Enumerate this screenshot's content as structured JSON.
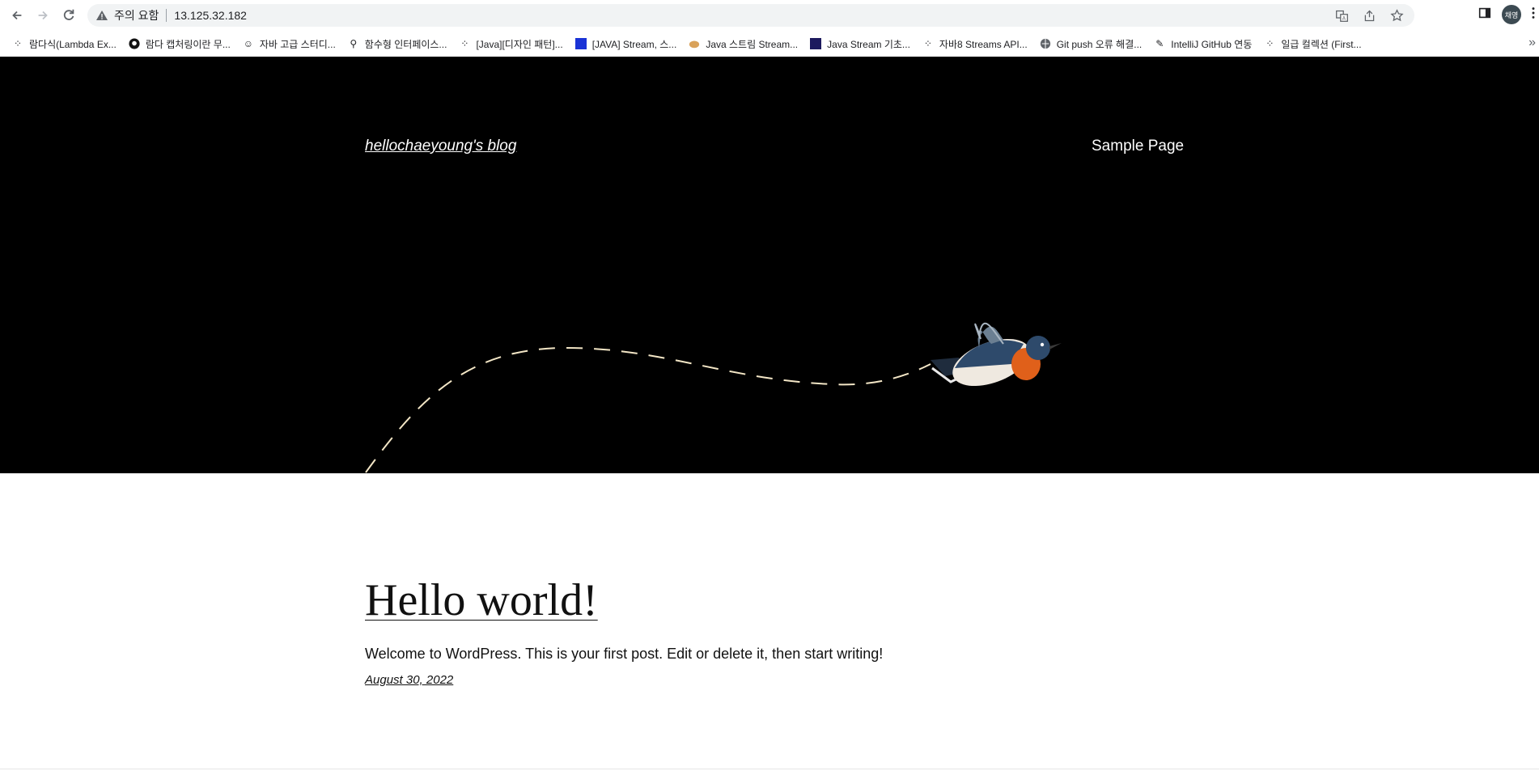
{
  "browser": {
    "security_label": "주의 요함",
    "url": "13.125.32.182",
    "profile_initials": "채영",
    "bookmarks": [
      {
        "label": "람다식(Lambda Ex...",
        "icon": "dots-icon"
      },
      {
        "label": "람다 캡처링이란 무...",
        "icon": "github-icon"
      },
      {
        "label": "자바 고급 스터디...",
        "icon": "smile-icon"
      },
      {
        "label": "함수형 인터페이스...",
        "icon": "runner-icon"
      },
      {
        "label": "[Java][디자인 패턴]...",
        "icon": "dots-icon"
      },
      {
        "label": "[JAVA] Stream, 스...",
        "icon": "blue-square-icon"
      },
      {
        "label": "Java 스트림 Stream...",
        "icon": "potato-icon"
      },
      {
        "label": "Java Stream 기초...",
        "icon": "navy-square-icon"
      },
      {
        "label": "자바8 Streams API...",
        "icon": "dots-icon"
      },
      {
        "label": "Git push 오류 해결...",
        "icon": "globe-icon"
      },
      {
        "label": "IntelliJ GitHub 연동",
        "icon": "pen-icon"
      },
      {
        "label": "일급 컬렉션 (First...",
        "icon": "dots-icon"
      }
    ]
  },
  "site": {
    "title": "hellochaeyoung's blog",
    "nav": [
      "Sample Page"
    ]
  },
  "post": {
    "title": "Hello world!",
    "body": "Welcome to WordPress. This is your first post. Edit or delete it, then start writing!",
    "date": "August 30, 2022"
  },
  "colors": {
    "hero_bg": "#000000",
    "path": "#f3e6c6",
    "bird_blue": "#2e4a6b",
    "bird_orange": "#e0601a"
  }
}
